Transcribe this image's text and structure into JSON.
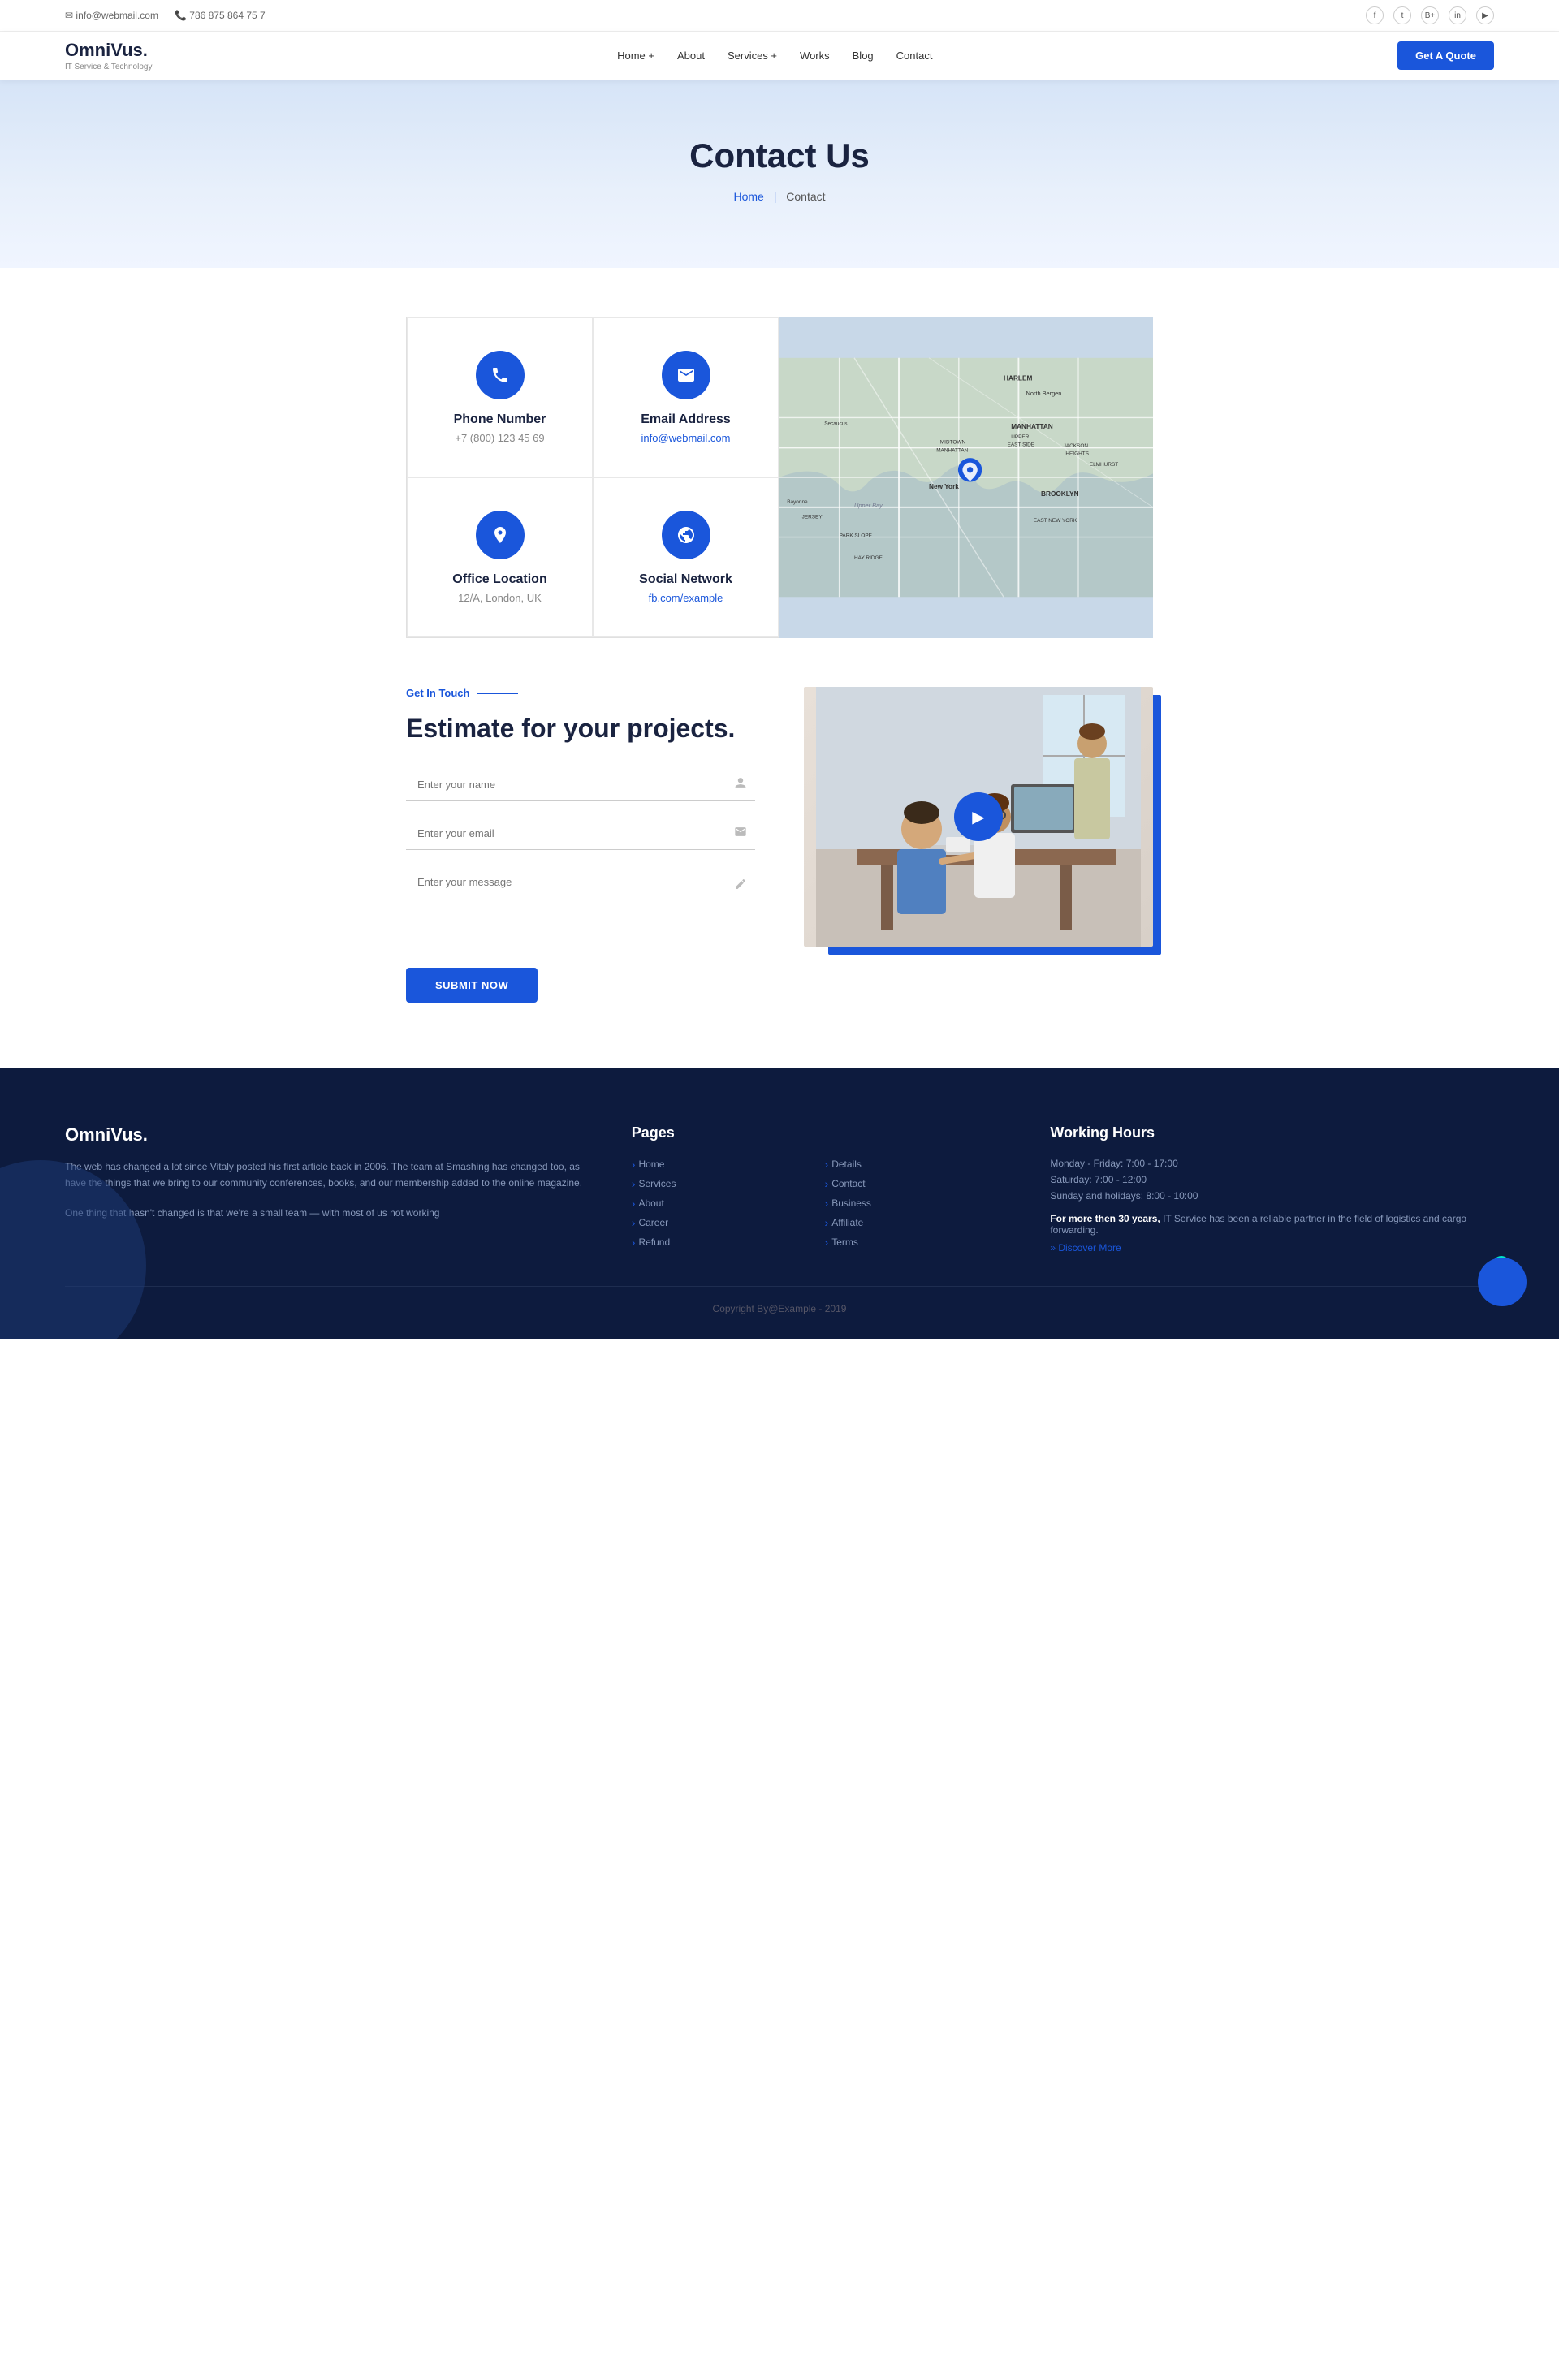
{
  "topbar": {
    "email_icon": "✉",
    "email": "info@webmail.com",
    "phone_icon": "📞",
    "phone": "786 875 864 75 7",
    "social": [
      "f",
      "t",
      "b+",
      "in",
      "▶"
    ]
  },
  "navbar": {
    "logo_name": "OmniVus.",
    "logo_tag": "IT Service & Technology",
    "links": [
      {
        "label": "Home +",
        "href": "#"
      },
      {
        "label": "About",
        "href": "#"
      },
      {
        "label": "Services +",
        "href": "#"
      },
      {
        "label": "Works",
        "href": "#"
      },
      {
        "label": "Blog",
        "href": "#"
      },
      {
        "label": "Contact",
        "href": "#"
      }
    ],
    "cta_label": "Get A Quote"
  },
  "hero": {
    "title": "Contact Us",
    "breadcrumb_home": "Home",
    "breadcrumb_current": "Contact"
  },
  "contact_cards": [
    {
      "icon": "☎",
      "title": "Phone Number",
      "value": "+7 (800) 123 45 69",
      "is_link": false
    },
    {
      "icon": "✉",
      "title": "Email Address",
      "value": "info@webmail.com",
      "is_link": true
    },
    {
      "icon": "📖",
      "title": "Office Location",
      "value": "12/A, London, UK",
      "is_link": false
    },
    {
      "icon": "🌐",
      "title": "Social Network",
      "value": "fb.com/example",
      "is_link": true
    }
  ],
  "get_in_touch": {
    "tag": "Get In Touch",
    "title": "Estimate for your projects.",
    "form": {
      "name_placeholder": "Enter your name",
      "email_placeholder": "Enter your email",
      "message_placeholder": "Enter your message",
      "submit_label": "Submit Now"
    },
    "play_button": "▶"
  },
  "footer": {
    "logo": "OmniVus.",
    "description1": "The web has changed a lot since Vitaly posted his first article back in 2006. The team at Smashing has changed too, as have the things that we bring to our community conferences, books, and our membership added to the online magazine.",
    "description2": "One thing that hasn't changed is that we're a small team — with most of us not working",
    "pages_title": "Pages",
    "pages": [
      {
        "label": "Home",
        "href": "#"
      },
      {
        "label": "Details",
        "href": "#"
      },
      {
        "label": "Services",
        "href": "#"
      },
      {
        "label": "Contact",
        "href": "#"
      },
      {
        "label": "About",
        "href": "#"
      },
      {
        "label": "Business",
        "href": "#"
      },
      {
        "label": "Career",
        "href": "#"
      },
      {
        "label": "Affiliate",
        "href": "#"
      },
      {
        "label": "Refund",
        "href": "#"
      },
      {
        "label": "Terms",
        "href": "#"
      }
    ],
    "working_hours_title": "Working Hours",
    "wh_items": [
      "Monday - Friday: 7:00 - 17:00",
      "Saturday: 7:00 - 12:00",
      "Sunday and holidays: 8:00 - 10:00"
    ],
    "wh_strong": "For more then 30 years,",
    "wh_desc": " IT Service has been a reliable partner in the field of logistics and cargo forwarding.",
    "discover_more": "» Discover More",
    "copyright": "Copyright By@Example - 2019"
  }
}
